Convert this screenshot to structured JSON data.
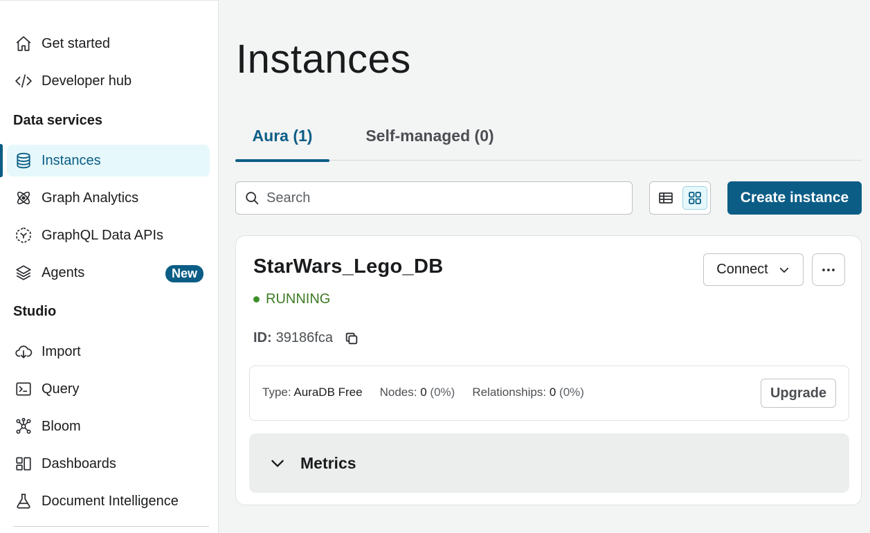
{
  "sidebar": {
    "items_top": [
      {
        "label": "Get started",
        "icon": "home-icon"
      },
      {
        "label": "Developer hub",
        "icon": "code-icon"
      }
    ],
    "sections": [
      {
        "title": "Data services"
      },
      {
        "title": "Studio"
      }
    ],
    "data_services": [
      {
        "label": "Instances",
        "icon": "database-icon",
        "active": true
      },
      {
        "label": "Graph Analytics",
        "icon": "atom-icon"
      },
      {
        "label": "GraphQL Data APIs",
        "icon": "graphql-icon"
      },
      {
        "label": "Agents",
        "icon": "layers-icon",
        "badge": "New"
      }
    ],
    "studio": [
      {
        "label": "Import",
        "icon": "cloud-download-icon"
      },
      {
        "label": "Query",
        "icon": "terminal-icon"
      },
      {
        "label": "Bloom",
        "icon": "graph-icon"
      },
      {
        "label": "Dashboards",
        "icon": "dashboard-icon"
      },
      {
        "label": "Document Intelligence",
        "icon": "flask-icon"
      }
    ]
  },
  "main": {
    "title": "Instances",
    "tabs": [
      {
        "label": "Aura (1)",
        "active": true
      },
      {
        "label": "Self-managed (0)",
        "active": false
      }
    ],
    "search": {
      "placeholder": "Search",
      "value": ""
    },
    "create_label": "Create instance",
    "instance": {
      "name": "StarWars_Lego_DB",
      "status": "RUNNING",
      "id_label": "ID:",
      "id_value": "39186fca",
      "connect_label": "Connect",
      "type_label": "Type:",
      "type_value": "AuraDB Free",
      "nodes_label": "Nodes:",
      "nodes_value": "0",
      "nodes_pct": "(0%)",
      "rels_label": "Relationships:",
      "rels_value": "0",
      "rels_pct": "(0%)",
      "upgrade_label": "Upgrade",
      "metrics_label": "Metrics"
    }
  },
  "colors": {
    "accent": "#0b5d86",
    "active_bg": "#e6f8fb",
    "running": "#3d7a24"
  }
}
